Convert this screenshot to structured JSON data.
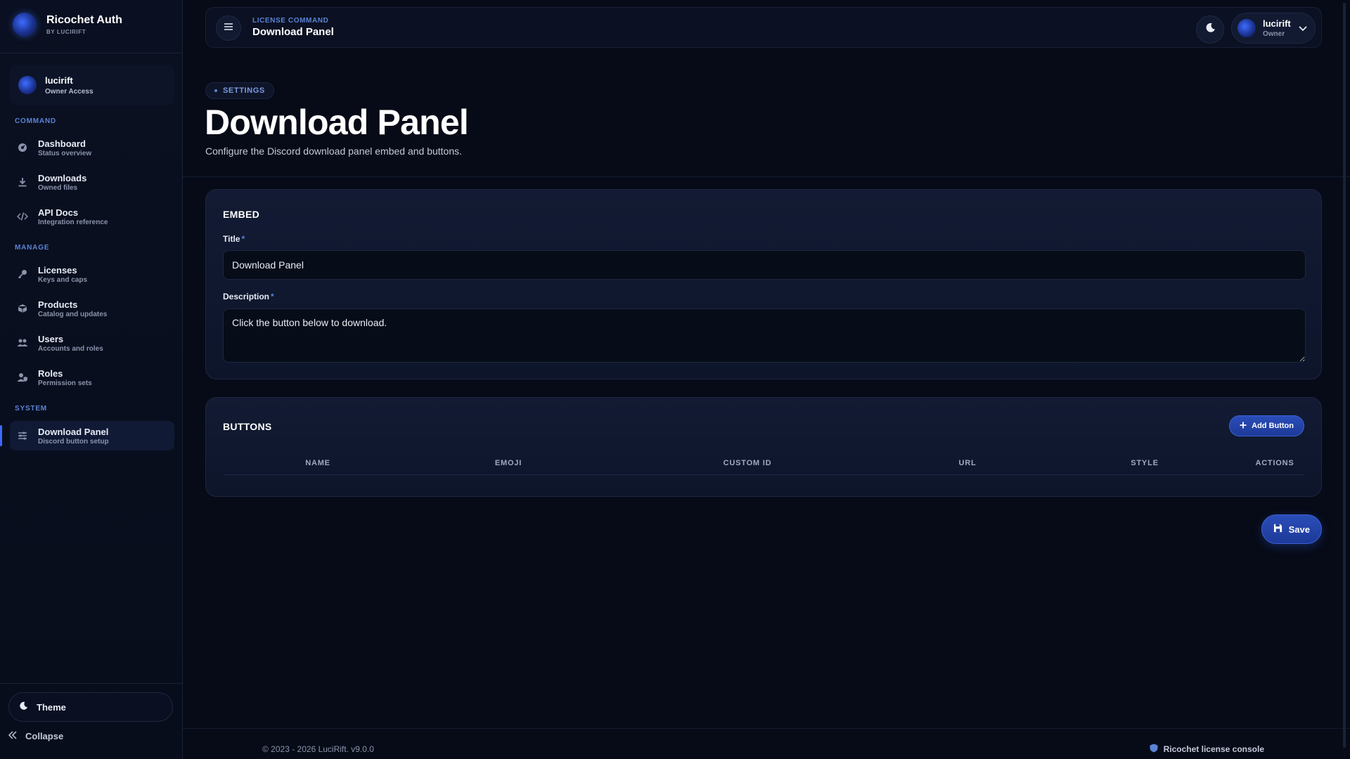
{
  "brand": {
    "title": "Ricochet Auth",
    "subtitle": "BY LUCIRIFT"
  },
  "sidebar": {
    "user": {
      "name": "lucirift",
      "role": "Owner Access"
    },
    "sections": {
      "command": "COMMAND",
      "manage": "MANAGE",
      "system": "SYSTEM"
    },
    "items": [
      {
        "title": "Dashboard",
        "sub": "Status overview",
        "icon": "gauge-icon"
      },
      {
        "title": "Downloads",
        "sub": "Owned files",
        "icon": "download-icon"
      },
      {
        "title": "API Docs",
        "sub": "Integration reference",
        "icon": "code-icon"
      },
      {
        "title": "Licenses",
        "sub": "Keys and caps",
        "icon": "key-icon"
      },
      {
        "title": "Products",
        "sub": "Catalog and updates",
        "icon": "box-icon"
      },
      {
        "title": "Users",
        "sub": "Accounts and roles",
        "icon": "users-icon"
      },
      {
        "title": "Roles",
        "sub": "Permission sets",
        "icon": "user-shield-icon"
      },
      {
        "title": "Download Panel",
        "sub": "Discord button setup",
        "icon": "sliders-icon",
        "active": true
      }
    ],
    "theme_label": "Theme",
    "collapse_label": "Collapse"
  },
  "topbar": {
    "crumb": "LICENSE COMMAND",
    "title": "Download Panel",
    "user": {
      "name": "lucirift",
      "role": "Owner"
    }
  },
  "header": {
    "badge": "SETTINGS",
    "title": "Download Panel",
    "subtitle": "Configure the Discord download panel embed and buttons."
  },
  "embed": {
    "section_title": "EMBED",
    "title_label": "Title",
    "title_value": "Download Panel",
    "description_label": "Description",
    "description_value": "Click the button below to download.",
    "required_mark": "*"
  },
  "buttons": {
    "section_title": "BUTTONS",
    "add_label": "Add Button",
    "columns": [
      "NAME",
      "EMOJI",
      "CUSTOM ID",
      "URL",
      "STYLE",
      "ACTIONS"
    ]
  },
  "actions": {
    "save_label": "Save"
  },
  "footer": {
    "copyright": "© 2023 - 2026 LuciRift. v9.0.0",
    "console_label": "Ricochet license console"
  },
  "colors": {
    "accent": "#3b6bff",
    "background": "#070b17",
    "card": "#121b33",
    "muted": "#8a93ab"
  }
}
